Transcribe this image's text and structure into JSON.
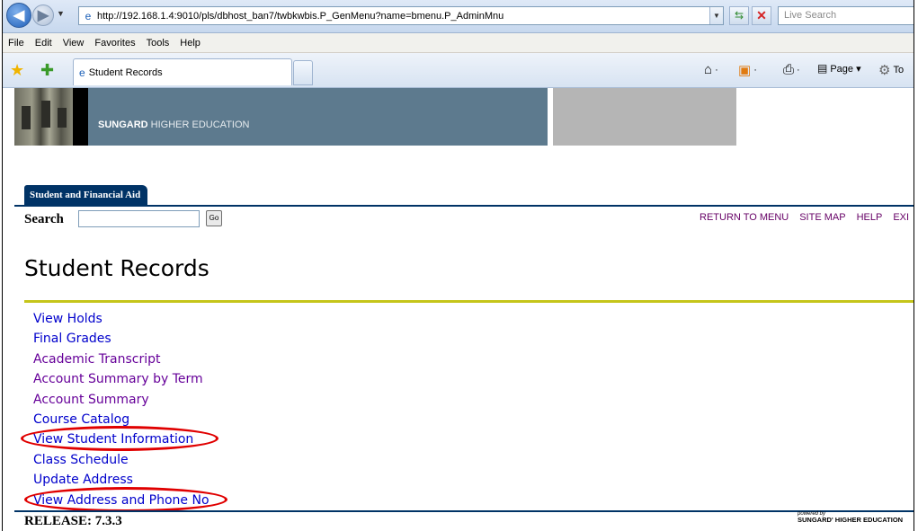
{
  "browser": {
    "url": "http://192.168.1.4:9010/pls/dbhost_ban7/twbkwbis.P_GenMenu?name=bmenu.P_AdminMnu",
    "search_placeholder": "Live Search",
    "menu": [
      "File",
      "Edit",
      "View",
      "Favorites",
      "Tools",
      "Help"
    ],
    "tab_title": "Student Records",
    "commands": {
      "page": "Page ▾",
      "tools": "To"
    }
  },
  "banner": {
    "brand_bold": "SUNGARD",
    "brand_rest": " HIGHER EDUCATION"
  },
  "page": {
    "tab": "Student and Financial Aid",
    "search_label": "Search",
    "go_label": "Go",
    "top_links": [
      "RETURN TO MENU",
      "SITE MAP",
      "HELP",
      "EXI"
    ],
    "title": "Student Records",
    "links": [
      {
        "label": "View Holds",
        "visited": false
      },
      {
        "label": "Final Grades",
        "visited": false
      },
      {
        "label": "Academic Transcript",
        "visited": true
      },
      {
        "label": "Account Summary by Term",
        "visited": true
      },
      {
        "label": "Account Summary",
        "visited": true
      },
      {
        "label": "Course Catalog",
        "visited": false
      },
      {
        "label": "View Student Information",
        "visited": false
      },
      {
        "label": "Class Schedule",
        "visited": false
      },
      {
        "label": "Update Address",
        "visited": false
      },
      {
        "label": "View Address and Phone No",
        "visited": false
      }
    ],
    "release": "RELEASE: 7.3.3",
    "powered_by": "powered by",
    "footer_brand": "SUNGARD' HIGHER EDUCATION"
  },
  "colors": {
    "link": "#0000cc",
    "visited": "#660099",
    "annotation": "#e00000",
    "banner": "#5d7a8e",
    "rule": "#c5c51a"
  }
}
